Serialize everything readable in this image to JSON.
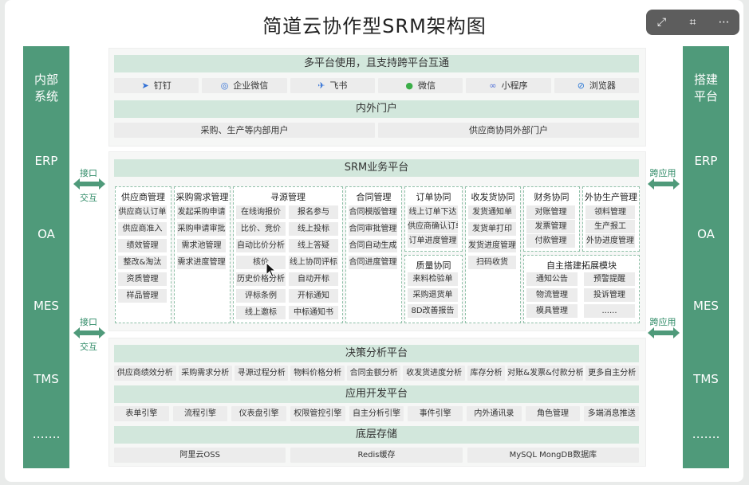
{
  "title": "简道云协作型SRM架构图",
  "toolbar": {
    "expand_icon": "⤢",
    "scan_icon": "⌗",
    "more_icon": "⋯"
  },
  "left_panel": {
    "title_line1": "内部",
    "title_line2": "系统",
    "items": [
      "ERP",
      "OA",
      "MES",
      "TMS",
      "……."
    ]
  },
  "right_panel": {
    "title_line1": "搭建",
    "title_line2": "平台",
    "items": [
      "ERP",
      "OA",
      "MES",
      "TMS",
      "……."
    ]
  },
  "arrows": {
    "left_top_label1": "接口",
    "left_top_label2": "交互",
    "left_bottom_label1": "接口",
    "left_bottom_label2": "交互",
    "right_top_label": "跨应用",
    "right_bottom_label": "跨应用"
  },
  "multi_platform": {
    "header": "多平台使用，且支持跨平台互通",
    "platforms": [
      {
        "icon": "dingtalk-icon",
        "glyph": "➤",
        "label": "钉钉"
      },
      {
        "icon": "wecom-icon",
        "glyph": "◎",
        "label": "企业微信"
      },
      {
        "icon": "feishu-icon",
        "glyph": "✈",
        "label": "飞书"
      },
      {
        "icon": "wechat-icon",
        "glyph": "●",
        "label": "微信"
      },
      {
        "icon": "miniprogram-icon",
        "glyph": "∞",
        "label": "小程序"
      },
      {
        "icon": "browser-icon",
        "glyph": "⊘",
        "label": "浏览器"
      }
    ]
  },
  "portal": {
    "header": "内外门户",
    "items": [
      "采购、生产等内部用户",
      "供应商协同外部门户"
    ]
  },
  "srm": {
    "header": "SRM业务平台",
    "supplier": {
      "title": "供应商管理",
      "items": [
        "供应商认订单",
        "供应商准入",
        "绩效管理",
        "整改&淘汰",
        "资质管理",
        "样品管理"
      ]
    },
    "purchase_req": {
      "title": "采购需求管理",
      "items": [
        "发起采购申请",
        "采购申请审批",
        "需求池管理",
        "需求进度管理"
      ]
    },
    "sourcing": {
      "title": "寻源管理",
      "left": [
        "在线询报价",
        "比价、竞价",
        "自动比价分析",
        "核价",
        "历史价格分析",
        "评标条例",
        "线上邀标"
      ],
      "right": [
        "报名参与",
        "线上投标",
        "线上答疑",
        "线上协同评标",
        "自动开标",
        "开标通知",
        "中标通知书"
      ]
    },
    "contract": {
      "title": "合同管理",
      "items": [
        "合同模版管理",
        "合同审批管理",
        "合同自动生成",
        "合同进度管理"
      ]
    },
    "order": {
      "title": "订单协同",
      "items": [
        "线上订单下达",
        "供应商确认订单",
        "订单进度管理"
      ]
    },
    "quality": {
      "title": "质量协同",
      "items": [
        "来料检验单",
        "采购退货单",
        "8D改善报告"
      ]
    },
    "delivery": {
      "title": "收发货协同",
      "items": [
        "发货通知单",
        "发货单打印",
        "发货进度管理",
        "扫码收货"
      ]
    },
    "finance": {
      "title": "财务协同",
      "items": [
        "对账管理",
        "发票管理",
        "付款管理"
      ]
    },
    "outsource": {
      "title": "外协生产管理",
      "items": [
        "领料管理",
        "生产报工",
        "外协进度管理"
      ]
    },
    "extension": {
      "title": "自主搭建拓展模块",
      "left": [
        "通知公告",
        "物流管理",
        "模具管理"
      ],
      "right": [
        "预警提醒",
        "投诉管理",
        "......"
      ]
    }
  },
  "decision": {
    "header": "决策分析平台",
    "items": [
      "供应商绩效分析",
      "采购需求分析",
      "寻源过程分析",
      "物料价格分析",
      "合同金额分析",
      "收发货进度分析",
      "库存分析",
      "对账&发票&付款分析",
      "更多自主分析"
    ]
  },
  "appdev": {
    "header": "应用开发平台",
    "items": [
      "表单引擎",
      "流程引擎",
      "仪表盘引擎",
      "权限管控引擎",
      "自主分析引擎",
      "事件引擎",
      "内外通讯录",
      "角色管理",
      "多端消息推送"
    ]
  },
  "storage": {
    "header": "底层存储",
    "items": [
      "阿里云OSS",
      "Redis缓存",
      "MySQL MongDB数据库"
    ]
  },
  "colors": {
    "green_dark": "#4f9a7a",
    "green_band": "#d2e7dc",
    "chip_gray": "#ececec",
    "dash_border": "#8fc0a8"
  }
}
